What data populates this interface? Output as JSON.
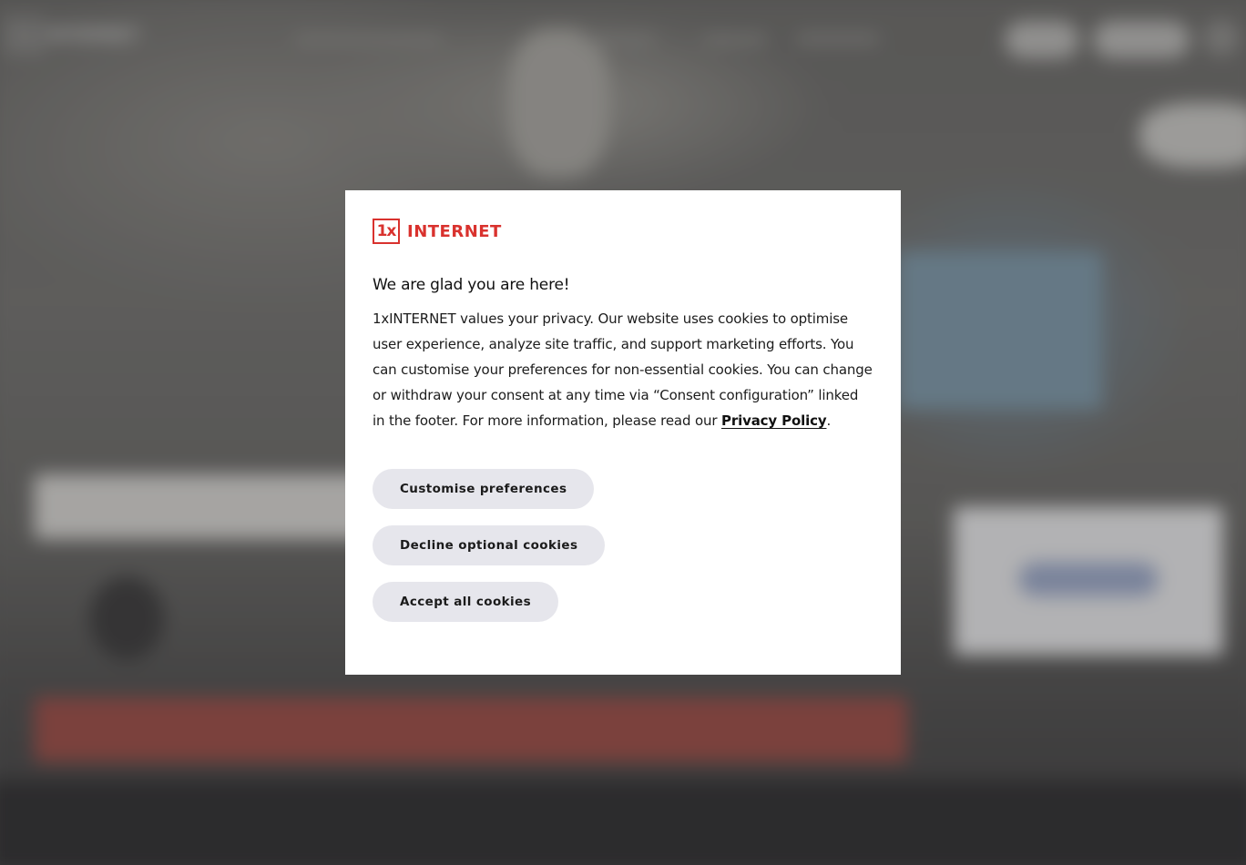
{
  "background": {
    "logo": {
      "mark": "1x",
      "word": "INTERNET"
    }
  },
  "consent_modal": {
    "brand": {
      "mark": "1x",
      "word": "INTERNET",
      "color": "#d9322e"
    },
    "title": "We are glad you are here!",
    "body_text": "1xINTERNET values your privacy. Our website uses cookies to optimise user experience, analyze site traffic, and support marketing efforts. You can customise your preferences for non-essential cookies. You can change or withdraw your consent at any time via “Consent configuration” linked in the footer. For more information, please read our ",
    "privacy_link_label": "Privacy Policy",
    "body_end": ".",
    "buttons": {
      "customise_label": "Customise preferences",
      "decline_label": "Decline optional cookies",
      "accept_label": "Accept all cookies"
    },
    "button_color": "#e6e6ec"
  }
}
